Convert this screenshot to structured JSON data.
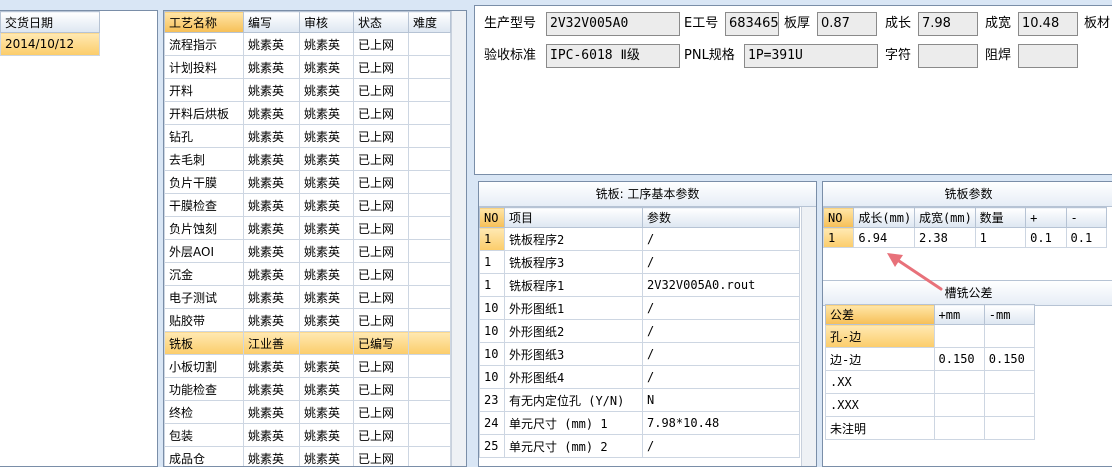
{
  "left": {
    "header": "交货日期",
    "date": "2014/10/12"
  },
  "process": {
    "headers": [
      "工艺名称",
      "编写",
      "审核",
      "状态",
      "难度"
    ],
    "rows": [
      {
        "name": "流程指示",
        "writer": "姚素英",
        "reviewer": "姚素英",
        "status": "已上网",
        "difficulty": ""
      },
      {
        "name": "计划投料",
        "writer": "姚素英",
        "reviewer": "姚素英",
        "status": "已上网",
        "difficulty": ""
      },
      {
        "name": "开料",
        "writer": "姚素英",
        "reviewer": "姚素英",
        "status": "已上网",
        "difficulty": ""
      },
      {
        "name": "开料后烘板",
        "writer": "姚素英",
        "reviewer": "姚素英",
        "status": "已上网",
        "difficulty": ""
      },
      {
        "name": "钻孔",
        "writer": "姚素英",
        "reviewer": "姚素英",
        "status": "已上网",
        "difficulty": ""
      },
      {
        "name": "去毛刺",
        "writer": "姚素英",
        "reviewer": "姚素英",
        "status": "已上网",
        "difficulty": ""
      },
      {
        "name": "负片干膜",
        "writer": "姚素英",
        "reviewer": "姚素英",
        "status": "已上网",
        "difficulty": ""
      },
      {
        "name": "干膜检查",
        "writer": "姚素英",
        "reviewer": "姚素英",
        "status": "已上网",
        "difficulty": ""
      },
      {
        "name": "负片蚀刻",
        "writer": "姚素英",
        "reviewer": "姚素英",
        "status": "已上网",
        "difficulty": ""
      },
      {
        "name": "外层AOI",
        "writer": "姚素英",
        "reviewer": "姚素英",
        "status": "已上网",
        "difficulty": ""
      },
      {
        "name": "沉金",
        "writer": "姚素英",
        "reviewer": "姚素英",
        "status": "已上网",
        "difficulty": ""
      },
      {
        "name": "电子测试",
        "writer": "姚素英",
        "reviewer": "姚素英",
        "status": "已上网",
        "difficulty": ""
      },
      {
        "name": "贴胶带",
        "writer": "姚素英",
        "reviewer": "姚素英",
        "status": "已上网",
        "difficulty": ""
      },
      {
        "name": "铣板",
        "writer": "江业善",
        "reviewer": "",
        "status": "已编写",
        "difficulty": "",
        "selected": true
      },
      {
        "name": "小板切割",
        "writer": "姚素英",
        "reviewer": "姚素英",
        "status": "已上网",
        "difficulty": ""
      },
      {
        "name": "功能检查",
        "writer": "姚素英",
        "reviewer": "姚素英",
        "status": "已上网",
        "difficulty": ""
      },
      {
        "name": "终检",
        "writer": "姚素英",
        "reviewer": "姚素英",
        "status": "已上网",
        "difficulty": ""
      },
      {
        "name": "包装",
        "writer": "姚素英",
        "reviewer": "姚素英",
        "status": "已上网",
        "difficulty": ""
      },
      {
        "name": "成品仓",
        "writer": "姚素英",
        "reviewer": "姚素英",
        "status": "已上网",
        "difficulty": ""
      }
    ]
  },
  "info": {
    "model_label": "生产型号",
    "model_value": "2V32V005A0",
    "ework_label": "E工号",
    "ework_value": "683465",
    "thickness_label": "板厚",
    "thickness_value": "0.87",
    "length_label": "成长",
    "length_value": "7.98",
    "width_label": "成宽",
    "width_value": "10.48",
    "material_label": "板材",
    "standard_label": "验收标准",
    "standard_value": "IPC-6018 Ⅱ级",
    "pnl_label": "PNL规格",
    "pnl_value": "1P=391U",
    "char_label": "字符",
    "char_value": "",
    "mask_label": "阻焊",
    "mask_value": ""
  },
  "basic_params": {
    "title": "铣板: 工序基本参数",
    "headers": [
      "NO",
      "项目",
      "参数"
    ],
    "rows": [
      {
        "no": "1",
        "item": "铣板程序2",
        "param": "/",
        "selected": true
      },
      {
        "no": "1",
        "item": "铣板程序3",
        "param": "/"
      },
      {
        "no": "1",
        "item": "铣板程序1",
        "param": "2V32V005A0.rout"
      },
      {
        "no": "10",
        "item": "外形图纸1",
        "param": "/"
      },
      {
        "no": "10",
        "item": "外形图纸2",
        "param": "/"
      },
      {
        "no": "10",
        "item": "外形图纸3",
        "param": "/"
      },
      {
        "no": "10",
        "item": "外形图纸4",
        "param": "/"
      },
      {
        "no": "23",
        "item": "有无内定位孔 (Y/N)",
        "param": "N"
      },
      {
        "no": "24",
        "item": "单元尺寸 (mm) 1",
        "param": "7.98*10.48"
      },
      {
        "no": "25",
        "item": "单元尺寸 (mm) 2",
        "param": "/"
      }
    ]
  },
  "mill_params": {
    "title": "铣板参数",
    "headers": [
      "NO",
      "成长(mm)",
      "成宽(mm)",
      "数量",
      "+",
      "-"
    ],
    "rows": [
      {
        "no": "1",
        "length": "6.94",
        "width": "2.38",
        "qty": "1",
        "plus": "0.1",
        "minus": "0.1"
      }
    ]
  },
  "tolerance": {
    "title": "槽铣公差",
    "headers": [
      "公差",
      "+mm",
      "-mm"
    ],
    "rows": [
      {
        "name": "孔-边",
        "plus": "",
        "minus": "",
        "selected": true
      },
      {
        "name": "边-边",
        "plus": "0.150",
        "minus": "0.150"
      },
      {
        "name": ".XX",
        "plus": "",
        "minus": ""
      },
      {
        "name": ".XXX",
        "plus": "",
        "minus": ""
      },
      {
        "name": "未注明",
        "plus": "",
        "minus": ""
      }
    ]
  },
  "colors": {
    "selection": "#fbcc6a",
    "annotation_arrow": "#e8717a",
    "background": "#d9e6f5"
  }
}
